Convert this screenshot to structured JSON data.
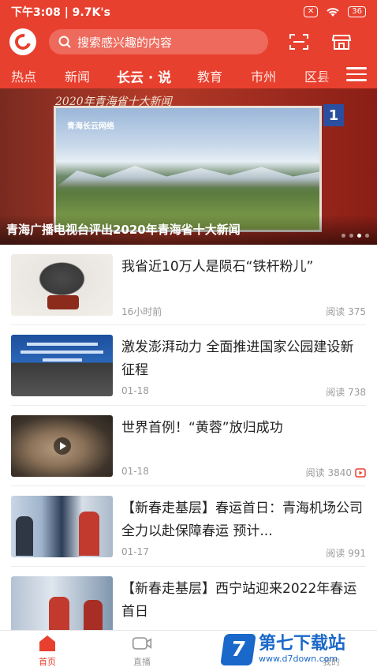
{
  "status_bar": {
    "time_speed": "下午3:08 | 9.7K's",
    "battery": "36"
  },
  "header": {
    "search_placeholder": "搜索感兴趣的内容"
  },
  "nav": {
    "tabs": [
      {
        "label": "热点"
      },
      {
        "label": "新闻"
      },
      {
        "label": "长云 · 说",
        "active": true
      },
      {
        "label": "教育"
      },
      {
        "label": "市州"
      },
      {
        "label": "区县"
      }
    ]
  },
  "banner": {
    "caption": "青海广播电视台评出2020年青海省十大新闻",
    "top_line": "2020年青海省十大新闻",
    "brand": "青海长云网络",
    "badge": "1"
  },
  "articles": [
    {
      "title": "我省近10万人是陨石“铁杆粉儿”",
      "time": "16小时前",
      "reads": "阅读 375",
      "video": false
    },
    {
      "title": "激发澎湃动力 全面推进国家公园建设新征程",
      "time": "01-18",
      "reads": "阅读 738",
      "video": false
    },
    {
      "title": "世界首例！“黄蓉”放归成功",
      "time": "01-18",
      "reads": "阅读 3840",
      "video": true
    },
    {
      "title": "【新春走基层】春运首日：青海机场公司全力以赴保障春运 预计...",
      "time": "01-17",
      "reads": "阅读 991",
      "video": false
    },
    {
      "title": "【新春走基层】西宁站迎来2022年春运首日",
      "time": "",
      "reads": "",
      "video": false
    }
  ],
  "tabbar": {
    "home": "首页",
    "live": "直播",
    "mine": "我的"
  },
  "watermark": {
    "name": "第七下载站",
    "url": "www.d7down.com",
    "logo": "7"
  },
  "colors": {
    "brand": "#e8402f",
    "watermark": "#1a68c9"
  }
}
